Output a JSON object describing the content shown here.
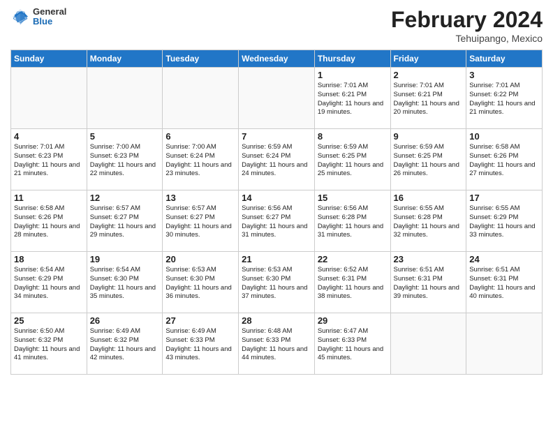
{
  "header": {
    "logo": {
      "general": "General",
      "blue": "Blue"
    },
    "title": "February 2024",
    "location": "Tehuipango, Mexico"
  },
  "days_of_week": [
    "Sunday",
    "Monday",
    "Tuesday",
    "Wednesday",
    "Thursday",
    "Friday",
    "Saturday"
  ],
  "weeks": [
    [
      {
        "day": "",
        "info": ""
      },
      {
        "day": "",
        "info": ""
      },
      {
        "day": "",
        "info": ""
      },
      {
        "day": "",
        "info": ""
      },
      {
        "day": "1",
        "info": "Sunrise: 7:01 AM\nSunset: 6:21 PM\nDaylight: 11 hours and 19 minutes."
      },
      {
        "day": "2",
        "info": "Sunrise: 7:01 AM\nSunset: 6:21 PM\nDaylight: 11 hours and 20 minutes."
      },
      {
        "day": "3",
        "info": "Sunrise: 7:01 AM\nSunset: 6:22 PM\nDaylight: 11 hours and 21 minutes."
      }
    ],
    [
      {
        "day": "4",
        "info": "Sunrise: 7:01 AM\nSunset: 6:23 PM\nDaylight: 11 hours and 21 minutes."
      },
      {
        "day": "5",
        "info": "Sunrise: 7:00 AM\nSunset: 6:23 PM\nDaylight: 11 hours and 22 minutes."
      },
      {
        "day": "6",
        "info": "Sunrise: 7:00 AM\nSunset: 6:24 PM\nDaylight: 11 hours and 23 minutes."
      },
      {
        "day": "7",
        "info": "Sunrise: 6:59 AM\nSunset: 6:24 PM\nDaylight: 11 hours and 24 minutes."
      },
      {
        "day": "8",
        "info": "Sunrise: 6:59 AM\nSunset: 6:25 PM\nDaylight: 11 hours and 25 minutes."
      },
      {
        "day": "9",
        "info": "Sunrise: 6:59 AM\nSunset: 6:25 PM\nDaylight: 11 hours and 26 minutes."
      },
      {
        "day": "10",
        "info": "Sunrise: 6:58 AM\nSunset: 6:26 PM\nDaylight: 11 hours and 27 minutes."
      }
    ],
    [
      {
        "day": "11",
        "info": "Sunrise: 6:58 AM\nSunset: 6:26 PM\nDaylight: 11 hours and 28 minutes."
      },
      {
        "day": "12",
        "info": "Sunrise: 6:57 AM\nSunset: 6:27 PM\nDaylight: 11 hours and 29 minutes."
      },
      {
        "day": "13",
        "info": "Sunrise: 6:57 AM\nSunset: 6:27 PM\nDaylight: 11 hours and 30 minutes."
      },
      {
        "day": "14",
        "info": "Sunrise: 6:56 AM\nSunset: 6:27 PM\nDaylight: 11 hours and 31 minutes."
      },
      {
        "day": "15",
        "info": "Sunrise: 6:56 AM\nSunset: 6:28 PM\nDaylight: 11 hours and 31 minutes."
      },
      {
        "day": "16",
        "info": "Sunrise: 6:55 AM\nSunset: 6:28 PM\nDaylight: 11 hours and 32 minutes."
      },
      {
        "day": "17",
        "info": "Sunrise: 6:55 AM\nSunset: 6:29 PM\nDaylight: 11 hours and 33 minutes."
      }
    ],
    [
      {
        "day": "18",
        "info": "Sunrise: 6:54 AM\nSunset: 6:29 PM\nDaylight: 11 hours and 34 minutes."
      },
      {
        "day": "19",
        "info": "Sunrise: 6:54 AM\nSunset: 6:30 PM\nDaylight: 11 hours and 35 minutes."
      },
      {
        "day": "20",
        "info": "Sunrise: 6:53 AM\nSunset: 6:30 PM\nDaylight: 11 hours and 36 minutes."
      },
      {
        "day": "21",
        "info": "Sunrise: 6:53 AM\nSunset: 6:30 PM\nDaylight: 11 hours and 37 minutes."
      },
      {
        "day": "22",
        "info": "Sunrise: 6:52 AM\nSunset: 6:31 PM\nDaylight: 11 hours and 38 minutes."
      },
      {
        "day": "23",
        "info": "Sunrise: 6:51 AM\nSunset: 6:31 PM\nDaylight: 11 hours and 39 minutes."
      },
      {
        "day": "24",
        "info": "Sunrise: 6:51 AM\nSunset: 6:31 PM\nDaylight: 11 hours and 40 minutes."
      }
    ],
    [
      {
        "day": "25",
        "info": "Sunrise: 6:50 AM\nSunset: 6:32 PM\nDaylight: 11 hours and 41 minutes."
      },
      {
        "day": "26",
        "info": "Sunrise: 6:49 AM\nSunset: 6:32 PM\nDaylight: 11 hours and 42 minutes."
      },
      {
        "day": "27",
        "info": "Sunrise: 6:49 AM\nSunset: 6:33 PM\nDaylight: 11 hours and 43 minutes."
      },
      {
        "day": "28",
        "info": "Sunrise: 6:48 AM\nSunset: 6:33 PM\nDaylight: 11 hours and 44 minutes."
      },
      {
        "day": "29",
        "info": "Sunrise: 6:47 AM\nSunset: 6:33 PM\nDaylight: 11 hours and 45 minutes."
      },
      {
        "day": "",
        "info": ""
      },
      {
        "day": "",
        "info": ""
      }
    ]
  ]
}
